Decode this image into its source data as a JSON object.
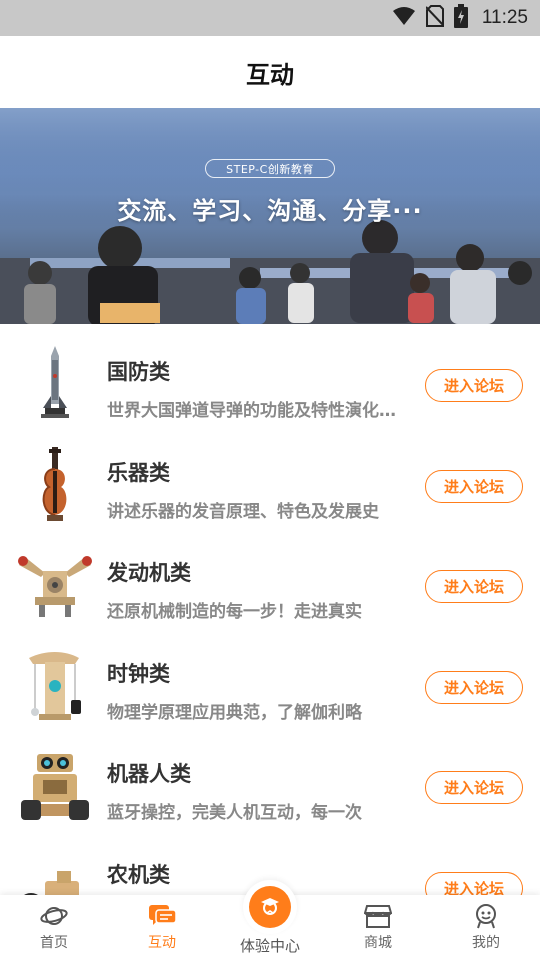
{
  "status_bar": {
    "time": "11:25",
    "icons": [
      "wifi-icon",
      "no-sim-icon",
      "battery-charging-icon"
    ]
  },
  "header": {
    "title": "互动"
  },
  "banner": {
    "tag": "STEP-C创新教育",
    "slogan": "交流、学习、沟通、分享···"
  },
  "forums": [
    {
      "title": "国防类",
      "desc": "世界大国弹道导弹的功能及特性演化…",
      "button": "进入论坛",
      "icon": "rocket-model-icon"
    },
    {
      "title": "乐器类",
      "desc": "讲述乐器的发音原理、特色及发展史",
      "button": "进入论坛",
      "icon": "violin-model-icon"
    },
    {
      "title": "发动机类",
      "desc": "还原机械制造的每一步！走进真实",
      "button": "进入论坛",
      "icon": "engine-model-icon"
    },
    {
      "title": "时钟类",
      "desc": "物理学原理应用典范，了解伽利略",
      "button": "进入论坛",
      "icon": "clock-model-icon"
    },
    {
      "title": "机器人类",
      "desc": "蓝牙操控，完美人机互动，每一次",
      "button": "进入论坛",
      "icon": "robot-model-icon"
    },
    {
      "title": "农机类",
      "desc": "",
      "button": "进入论坛",
      "icon": "tractor-model-icon"
    }
  ],
  "tabs": [
    {
      "label": "首页",
      "icon": "planet-icon",
      "active": false
    },
    {
      "label": "互动",
      "icon": "chat-icon",
      "active": true
    },
    {
      "label": "体验中心",
      "icon": "graduate-icon",
      "active": false
    },
    {
      "label": "商城",
      "icon": "store-icon",
      "active": false
    },
    {
      "label": "我的",
      "icon": "user-icon",
      "active": false
    }
  ],
  "colors": {
    "accent": "#ff7d1a",
    "status_bar": "#c8c8c8"
  }
}
